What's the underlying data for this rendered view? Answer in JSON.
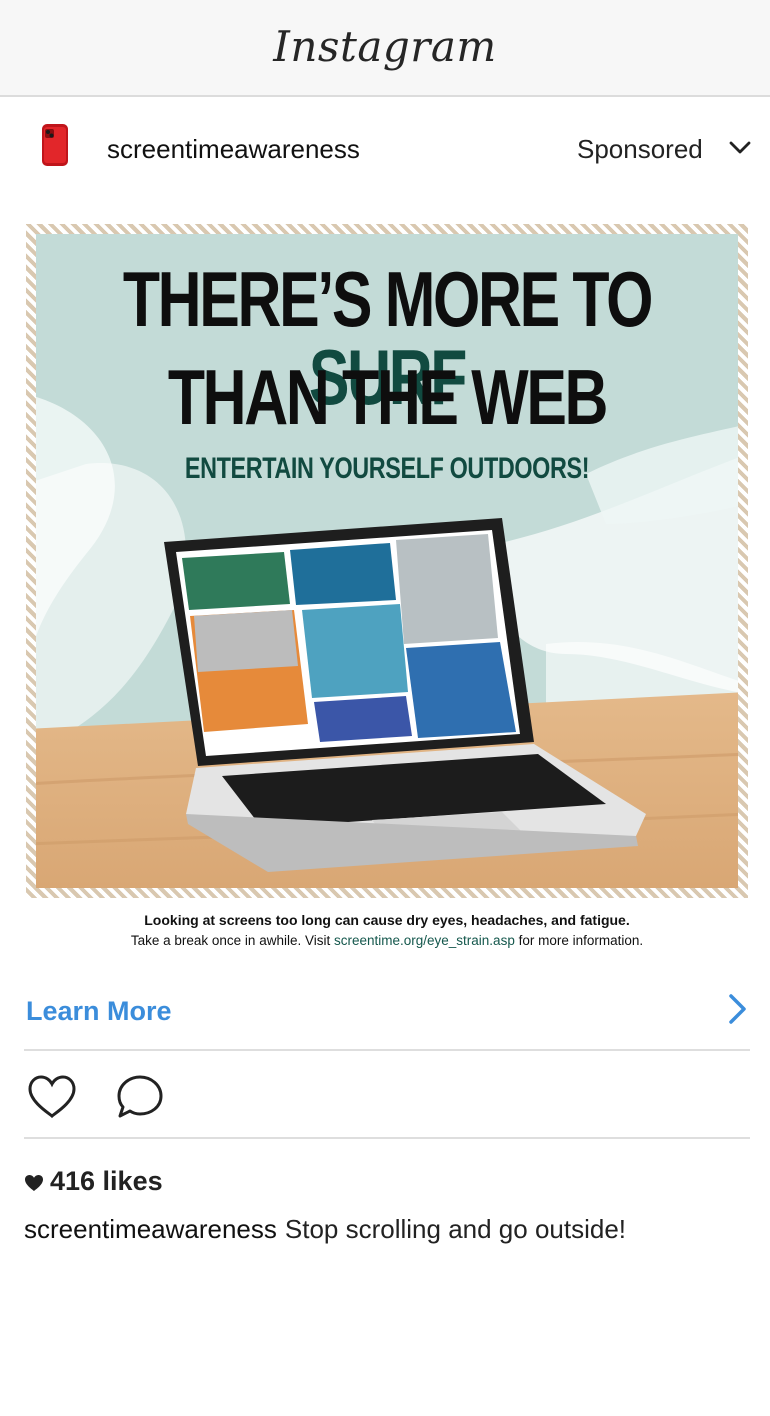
{
  "app": {
    "title": "Instagram"
  },
  "post": {
    "username": "screentimeawareness",
    "sponsored_label": "Sponsored",
    "ad": {
      "headline_line1_a": "THERE’S MORE TO ",
      "headline_line1_b": "SURF",
      "headline_line2": "THAN THE WEB",
      "tagline": "ENTERTAIN YOURSELF OUTDOORS!",
      "disclaimer_line1": "Looking at screens too long can cause dry eyes, headaches, and fatigue.",
      "disclaimer_line2_a": "Take a break once in awhile. Visit ",
      "disclaimer_link": "screentime.org/eye_strain.asp",
      "disclaimer_line2_b": " for more information."
    },
    "cta_label": "Learn More",
    "likes": "416 likes",
    "caption_user": "screentimeawareness",
    "caption_text": "Stop scrolling and go outside!"
  },
  "icons": {
    "avatar": "phone-icon",
    "sponsored": "chevron-down-icon",
    "cta": "chevron-right-icon",
    "like": "heart-icon",
    "comment": "comment-icon"
  },
  "colors": {
    "link_blue": "#3b8ddb",
    "brand_green": "#114a40"
  }
}
